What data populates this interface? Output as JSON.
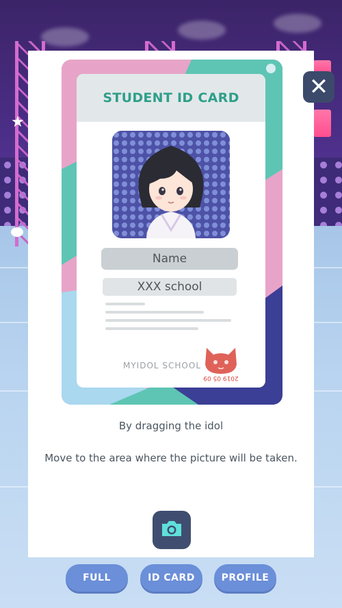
{
  "card": {
    "title": "STUDENT ID CARD",
    "name_field": "Name",
    "school_field": "XXX school",
    "school_mark": "MYIDOL SCHOOL",
    "stamp_text": "2019 05 09"
  },
  "instructions": {
    "line1": "By dragging the idol",
    "line2": "Move to the area where the picture will be taken."
  },
  "tabs": [
    {
      "label": "FULL"
    },
    {
      "label": "ID CARD"
    },
    {
      "label": "PROFILE"
    }
  ],
  "icons": {
    "close": "close-icon",
    "camera": "camera-icon",
    "star": "star-icon",
    "speech": "speech-bubble-icon"
  },
  "colors": {
    "card_title": "#2f9f8a",
    "card_pink": "#e7a4c8",
    "card_teal": "#5ec5b4",
    "card_navy": "#3b3f95",
    "card_lightblue": "#a9d8ef",
    "tab_bg": "#6b8fd8",
    "camera_icon": "#5fe0d8",
    "stamp": "#d9473c"
  }
}
